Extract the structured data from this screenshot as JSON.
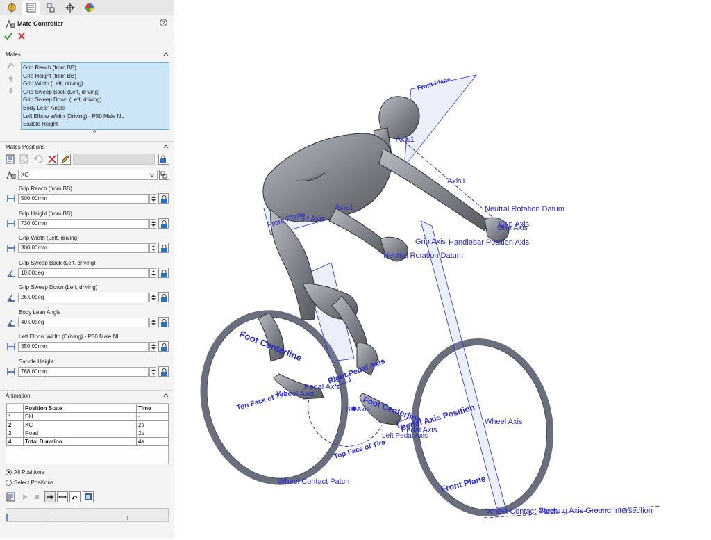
{
  "panel": {
    "title": "Mate Controller",
    "help_icon": "question-circle-icon",
    "ok_icon": "green-check-icon",
    "cancel_icon": "red-x-icon"
  },
  "tabs": [
    "feature-manager-icon",
    "property-manager-icon",
    "configuration-manager-icon",
    "dimxpert-icon",
    "display-manager-icon"
  ],
  "mates": {
    "header": "Mates",
    "items": [
      "Grip Reach (from BB)",
      "Grip Height (from BB)",
      "Grip Width (Left, driving)",
      "Grip Sweep Back (Left, driving)",
      "Grip Sweep Down (Left, driving)",
      "Body Lean Angle",
      "Left Elbow Width (Driving) - P50 Male NL",
      "Saddle Height"
    ]
  },
  "positions": {
    "header": "Mates Positions",
    "selected": "XC",
    "fields": [
      {
        "label": "Grip Reach (from BB)",
        "value": "500.00mm"
      },
      {
        "label": "Grip Height (from BB)",
        "value": "730.00mm"
      },
      {
        "label": "Grip Width (Left, driving)",
        "value": "300.00mm"
      },
      {
        "label": "Grip Sweep Back (Left, driving)",
        "value": "10.00deg"
      },
      {
        "label": "Grip Sweep Down (Left, driving)",
        "value": "26.00deg"
      },
      {
        "label": "Body Lean Angle",
        "value": "40.00deg"
      },
      {
        "label": "Left Elbow Width (Driving) - P50 Male NL",
        "value": "350.00mm"
      },
      {
        "label": "Saddle Height",
        "value": "768.00mm"
      }
    ]
  },
  "animation": {
    "header": "Animation",
    "columns": [
      "",
      "Position State",
      "Time"
    ],
    "rows": [
      [
        "1",
        "DH",
        "-"
      ],
      [
        "2",
        "XC",
        "2s"
      ],
      [
        "3",
        "Road",
        "2s"
      ],
      [
        "4",
        "Total Duration",
        "4s"
      ]
    ],
    "all_positions": "All Positions",
    "select_positions": "Select Positions"
  },
  "viewport": {
    "labels": {
      "front_plane_top": "Front Plane",
      "axis1_a": "Axis1",
      "axis1_b": "Axis1",
      "axis1_c": "Axis1",
      "neutral_rot_1": "Neutral Rotation Datum",
      "grip_axis_r": "Grip Axis",
      "grip_axis_r2": "Grip Axis",
      "handlebar": "Handlebar Position Axis",
      "grip_axis_l": "Grip Axis",
      "neutral_rot_2": "Neutral Rotation Datum",
      "sit_axis": "Sit Axis",
      "front_plane_torso": "Front Plane",
      "foot_centerline_l": "Foot Centerline",
      "right_pedal_axis": "Right Pedal Axis",
      "pedal_axis_1": "Pedal Axis",
      "wheel_axis_rear": "Wheel Axis",
      "top_face_rear": "Top Face of Tire",
      "bb_axis": "BB Axis",
      "foot_centerline_r": "Foot Centerline",
      "pedal_axis_position": "Pedal Axis Position",
      "pedal_axis_2": "Pedal Axis",
      "left_pedal_axis": "Left Pedal Axis",
      "top_face_front": "Top Face of Tire",
      "wheel_axis_front": "Wheel Axis",
      "wheel_contact_rear": "Wheel Contact Patch",
      "front_plane_fork": "Front Plane",
      "wheel_contact_front": "Wheel Contact Patch",
      "steering_ground": "Steering Axis Ground Intersection"
    }
  },
  "colors": {
    "accent": "#2a2ad0",
    "selection_bg": "#cde6f7",
    "selection_border": "#77b1da",
    "mannequin": "#8a8c91"
  }
}
